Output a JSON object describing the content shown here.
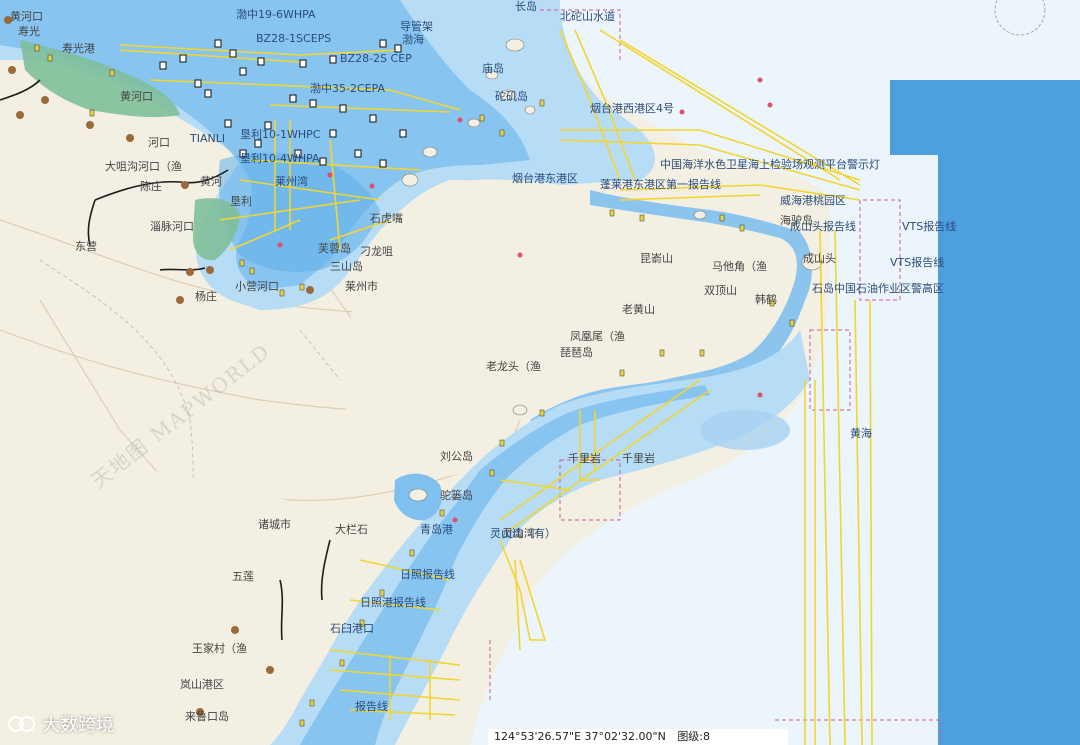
{
  "map": {
    "colors": {
      "land": "#f3efe2",
      "shallow": "#7fc0ee",
      "mid": "#b7dcf5",
      "deep": "#dcedf9",
      "open": "#ecf5fb",
      "ocean_block": "#4da0e0",
      "tidal": "#7fbf9a",
      "route": "#f2d530",
      "boundary": "#c85aa0",
      "roads": "#d7c7a8"
    },
    "labels_land": [
      "黄河口",
      "河口",
      "大咀沟河口（渔",
      "陈庄",
      "淄脉河口",
      "垦利",
      "杨庄",
      "小营河口",
      "东营",
      "黄河口",
      "黄河",
      "诸城市",
      "大栏石",
      "五莲",
      "王家村（渔",
      "岚山港区",
      "来鲁口岛",
      "寿光",
      "寿光港",
      "石虎嘴",
      "刁龙咀",
      "莱州市",
      "芙蓉岛",
      "三山岛",
      "昆嵛山",
      "老黄山",
      "双顶山",
      "马他角（渔",
      "韩鹤",
      "凤凰尾（渔",
      "琵琶岛",
      "老龙头（渔",
      "千里岩",
      "千里岩",
      "驼篓岛",
      "灵山湾",
      "刘公岛",
      "海驴岛",
      "成山头"
    ],
    "labels_sea": [
      "渤中19-6WHPA",
      "BZ28-1SCEPS",
      "BZ28-2S CEP",
      "渤中35-2CEPA",
      "渤海",
      "导管架",
      "TIANLI",
      "垦利10-1WHPC",
      "垦利10-4WHPA",
      "莱州湾",
      "长岛",
      "庙岛",
      "砣矶岛",
      "北砣山水道",
      "烟台港西港区4号",
      "烟台港东港区",
      "中国海洋水色卫星海上检验场观测平台警示灯",
      "蓬莱港东港区第一报告线",
      "威海港桃园区",
      "成山头报告线",
      "VTS报告线",
      "VTS报告线",
      "石岛中国石油作业区警高区",
      "黄海",
      "青岛港",
      "灵山湾（有）",
      "日照报告线",
      "日照港报告线",
      "石臼港口",
      "报告线"
    ],
    "status": {
      "coords": "124°53'26.57\"E  37°02'32.00\"N",
      "zoom_label": "图级:8"
    },
    "watermark": "大数跨境",
    "mapworld": "天地图 MAPWORLD"
  }
}
